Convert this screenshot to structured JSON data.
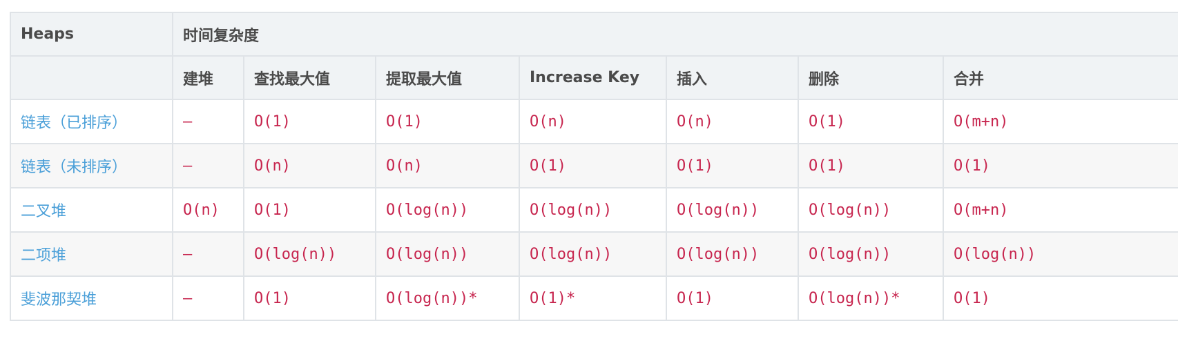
{
  "table": {
    "group_header": {
      "first": "Heaps",
      "span": "时间复杂度"
    },
    "columns": [
      "",
      "建堆",
      "查找最大值",
      "提取最大值",
      "Increase Key",
      "插入",
      "删除",
      "合并"
    ],
    "rows": [
      {
        "name": "链表（已排序）",
        "cells": [
          "–",
          "O(1)",
          "O(1)",
          "O(n)",
          "O(n)",
          "O(1)",
          "O(m+n)"
        ]
      },
      {
        "name": "链表（未排序）",
        "cells": [
          "–",
          "O(n)",
          "O(n)",
          "O(1)",
          "O(1)",
          "O(1)",
          "O(1)"
        ]
      },
      {
        "name": "二叉堆",
        "cells": [
          "O(n)",
          "O(1)",
          "O(log(n))",
          "O(log(n))",
          "O(log(n))",
          "O(log(n))",
          "O(m+n)"
        ]
      },
      {
        "name": "二项堆",
        "cells": [
          "–",
          "O(log(n))",
          "O(log(n))",
          "O(log(n))",
          "O(log(n))",
          "O(log(n))",
          "O(log(n))"
        ]
      },
      {
        "name": "斐波那契堆",
        "cells": [
          "–",
          "O(1)",
          "O(log(n))*",
          "O(1)*",
          "O(1)",
          "O(log(n))*",
          "O(1)"
        ]
      }
    ]
  }
}
